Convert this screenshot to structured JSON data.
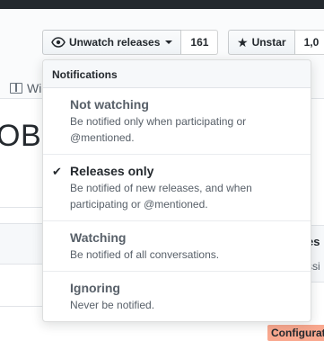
{
  "header": {
    "watch_label": "Unwatch releases",
    "watch_count": "161",
    "star_label": "Unstar",
    "star_count": "1,0"
  },
  "tabs": {
    "wiki_label": "Wi"
  },
  "page": {
    "title_fragment": "OBC"
  },
  "right_panel": {
    "fragment_1": "es",
    "fragment_2": "ssi",
    "label": "Configurat"
  },
  "dropdown": {
    "header": "Notifications",
    "options": [
      {
        "title": "Not watching",
        "desc": "Be notified only when participating or @mentioned.",
        "selected": false
      },
      {
        "title": "Releases only",
        "desc": "Be notified of new releases, and when participating or @mentioned.",
        "selected": true
      },
      {
        "title": "Watching",
        "desc": "Be notified of all conversations.",
        "selected": false
      },
      {
        "title": "Ignoring",
        "desc": "Never be notified.",
        "selected": false
      }
    ]
  },
  "colors": {
    "topbar": "#24292e",
    "label_bg": "#f9a88f"
  }
}
